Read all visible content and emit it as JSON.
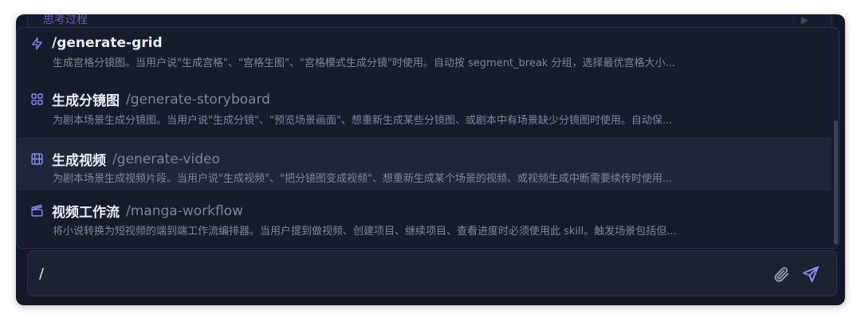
{
  "background": {
    "thinking_label": "思考过程",
    "play_icon": "play-icon"
  },
  "commands": [
    {
      "name": "/generate-grid",
      "slash": "",
      "icon": "lightning-icon",
      "description": "生成宫格分镜图。当用户说\"生成宫格\"、\"宫格生图\"、\"宫格模式生成分镜\"时使用。自动按 segment_break 分组，选择最优宫格大小..."
    },
    {
      "name": "生成分镜图",
      "slash": "/generate-storyboard",
      "icon": "grid-icon",
      "description": "为剧本场景生成分镜图。当用户说\"生成分镜\"、\"预览场景画面\"、想重新生成某些分镜图、或剧本中有场景缺少分镜图时使用。自动保..."
    },
    {
      "name": "生成视频",
      "slash": "/generate-video",
      "icon": "film-icon",
      "description": "为剧本场景生成视频片段。当用户说\"生成视频\"、\"把分镜图变成视频\"、想重新生成某个场景的视频、或视频生成中断需要续传时使用..."
    },
    {
      "name": "视频工作流",
      "slash": "/manga-workflow",
      "icon": "clapperboard-icon",
      "description": "将小说转换为短视频的端到端工作流编排器。当用户提到做视频、创建项目、继续项目、查看进度时必须使用此 skill。触发场景包括但..."
    }
  ],
  "input": {
    "value": "/"
  },
  "colors": {
    "accent": "#8b8cf6",
    "highlight_row": "#1f2839",
    "panel": "#151c2c"
  }
}
